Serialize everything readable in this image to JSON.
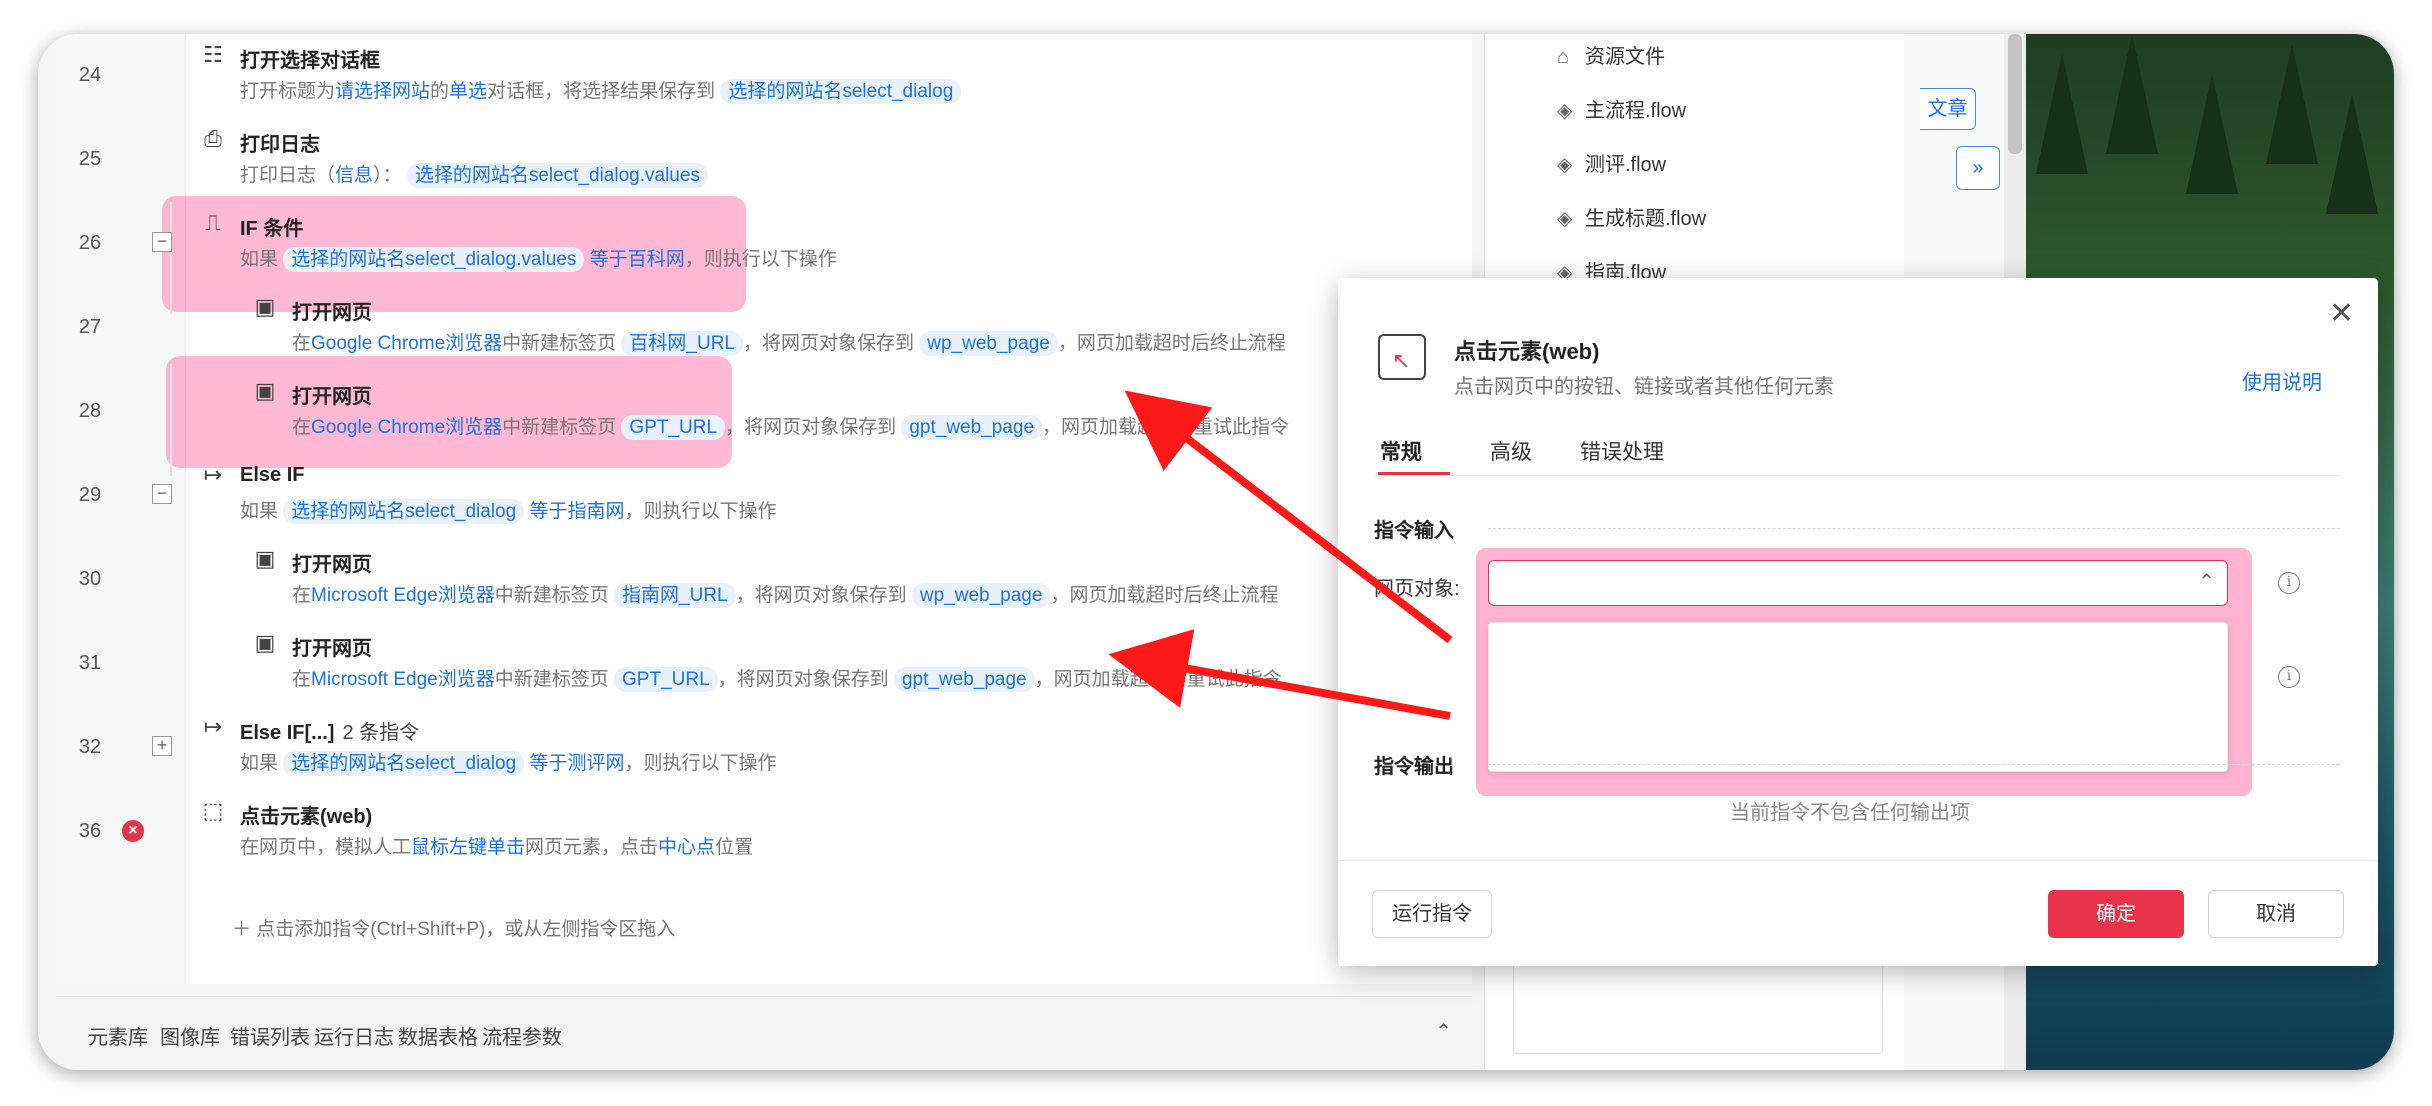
{
  "rows": [
    {
      "ln": "24",
      "title": "打开选择对话框",
      "desc": [
        "打开标题为",
        {
          "h": "请选择网站"
        },
        "的",
        {
          "h": "单选"
        },
        "对话框，将选择结果保存到 ",
        {
          "t": "选择的网站名select_dialog"
        }
      ]
    },
    {
      "ln": "25",
      "title": "打印日志",
      "desc": [
        "打印日志（",
        {
          "h": "信息"
        },
        "）： ",
        {
          "t": "选择的网站名select_dialog.values"
        }
      ]
    },
    {
      "ln": "26",
      "title": "IF 条件",
      "desc": [
        "如果 ",
        {
          "t": "选择的网站名select_dialog.values"
        },
        " ",
        {
          "h": "等于百科网"
        },
        "，则执行以下操作"
      ]
    },
    {
      "ln": "27",
      "title": "打开网页",
      "desc": [
        "在",
        {
          "h": "Google Chrome浏览器"
        },
        "中新建标签页 ",
        {
          "t": "百科网_URL"
        },
        "，将网页对象保存到 ",
        {
          "t": "wp_web_page"
        },
        "，网页加载超时后终止流程"
      ]
    },
    {
      "ln": "28",
      "title": "打开网页",
      "desc": [
        "在",
        {
          "h": "Google Chrome浏览器"
        },
        "中新建标签页 ",
        {
          "t": "GPT_URL"
        },
        "，将网页对象保存到 ",
        {
          "t": "gpt_web_page"
        },
        "，网页加载超时后重试此指令"
      ]
    },
    {
      "ln": "29",
      "title": "Else IF",
      "desc": [
        "如果 ",
        {
          "t": "选择的网站名select_dialog"
        },
        " ",
        {
          "h": "等于指南网"
        },
        "，则执行以下操作"
      ]
    },
    {
      "ln": "30",
      "title": "打开网页",
      "desc": [
        "在",
        {
          "h": "Microsoft Edge浏览器"
        },
        "中新建标签页 ",
        {
          "t": "指南网_URL"
        },
        "，将网页对象保存到 ",
        {
          "t": "wp_web_page"
        },
        "，网页加载超时后终止流程"
      ]
    },
    {
      "ln": "31",
      "title": "打开网页",
      "desc": [
        "在",
        {
          "h": "Microsoft Edge浏览器"
        },
        "中新建标签页 ",
        {
          "t": "GPT_URL"
        },
        "，将网页对象保存到 ",
        {
          "t": "gpt_web_page"
        },
        "，网页加载超时后重试此指令"
      ]
    },
    {
      "ln": "32",
      "title": "Else IF[...]",
      "suffix": "2 条指令",
      "desc": [
        "如果 ",
        {
          "t": "选择的网站名select_dialog"
        },
        " ",
        {
          "h": "等于测评网"
        },
        "，则执行以下操作"
      ]
    },
    {
      "ln": "36",
      "title": "点击元素(web)",
      "desc": [
        "在网页中，模拟人工",
        {
          "h": "鼠标左键单击"
        },
        "网页元素，点击",
        {
          "h": "中心点"
        },
        "位置"
      ]
    }
  ],
  "fold_minus": "−",
  "fold_plus": "+",
  "error_mark": "×",
  "add_command": "＋  点击添加指令(Ctrl+Shift+P)，或从左侧指令区拖入",
  "bottom_tabs": [
    "元素库",
    "图像库",
    "错误列表",
    "运行日志",
    "数据表格",
    "流程参数"
  ],
  "collapse_glyph": "⌃",
  "files": [
    "资源文件",
    "主流程.flow",
    "测评.flow",
    "生成标题.flow",
    "指南.flow"
  ],
  "side_buttons": {
    "article": "文章",
    "more": "»"
  },
  "dialog": {
    "close": "✕",
    "title": "点击元素(web)",
    "subtitle": "点击网页中的按钮、链接或者其他任何元素",
    "help": "使用说明",
    "tabs": [
      "常规",
      "高级",
      "错误处理"
    ],
    "section_input": "指令输入",
    "label_page": "网页对象:",
    "caret": "⌃",
    "info": "i",
    "section_output": "指令输出",
    "no_output": "当前指令不包含任何输出项",
    "run": "运行指令",
    "ok": "确定",
    "cancel": "取消"
  },
  "accent": "#e8344b",
  "link_color": "#1a73e8",
  "highlight": "#ff80b0"
}
